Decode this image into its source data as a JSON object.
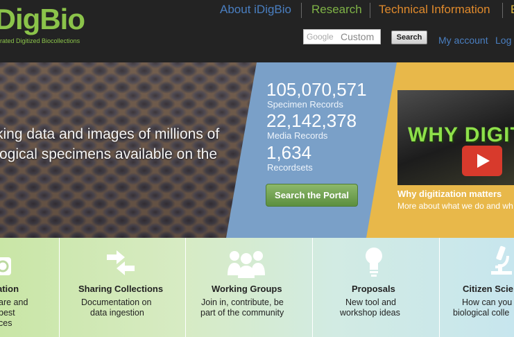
{
  "header": {
    "logo_text": "iDigBio",
    "logo_tagline": "Integrated Digitized Biocollections",
    "nav": [
      {
        "label": "About iDigBio",
        "color": "#4a7fc1"
      },
      {
        "label": "Research",
        "color": "#7fb347"
      },
      {
        "label": "Technical Information",
        "color": "#e08a2c"
      },
      {
        "label": "E",
        "color": "#d9b43c"
      }
    ],
    "search": {
      "brand": "Google",
      "placeholder": "Custom",
      "button_label": "Search"
    },
    "my_account_label": "My account",
    "log_label": "Log"
  },
  "hero": {
    "text_lines": [
      "king data and images of millions of",
      "ogical specimens available on the",
      "."
    ],
    "stats": [
      {
        "value": "105,070,571",
        "label": "Specimen Records"
      },
      {
        "value": "22,142,378",
        "label": "Media Records"
      },
      {
        "value": "1,634",
        "label": "Recordsets"
      }
    ],
    "portal_button_label": "Search the Portal",
    "video": {
      "thumbnail_text": "WHY DIGIT",
      "caption": "Why digitization matters",
      "subcaption": "More about what we do and wh"
    }
  },
  "features": [
    {
      "title": "ation",
      "lines": [
        "are and",
        "best",
        "ces"
      ],
      "icon": "camera-icon"
    },
    {
      "title": "Sharing Collections",
      "lines": [
        "Documentation on",
        "data ingestion"
      ],
      "icon": "exchange-arrows-icon"
    },
    {
      "title": "Working Groups",
      "lines": [
        "Join in, contribute, be",
        "part of the community"
      ],
      "icon": "people-group-icon"
    },
    {
      "title": "Proposals",
      "lines": [
        "New tool and",
        "workshop ideas"
      ],
      "icon": "lightbulb-icon"
    },
    {
      "title": "Citizen Scie",
      "lines": [
        "How can you",
        "biological colle"
      ],
      "icon": "microscope-icon"
    }
  ],
  "colors": {
    "accent_blue": "#4a7fc1",
    "accent_green": "#7fb347",
    "accent_orange": "#e08a2c",
    "stats_panel": "#7aa0c8",
    "gold_panel": "#e8b84a",
    "portal_button": "#6fa14f"
  }
}
